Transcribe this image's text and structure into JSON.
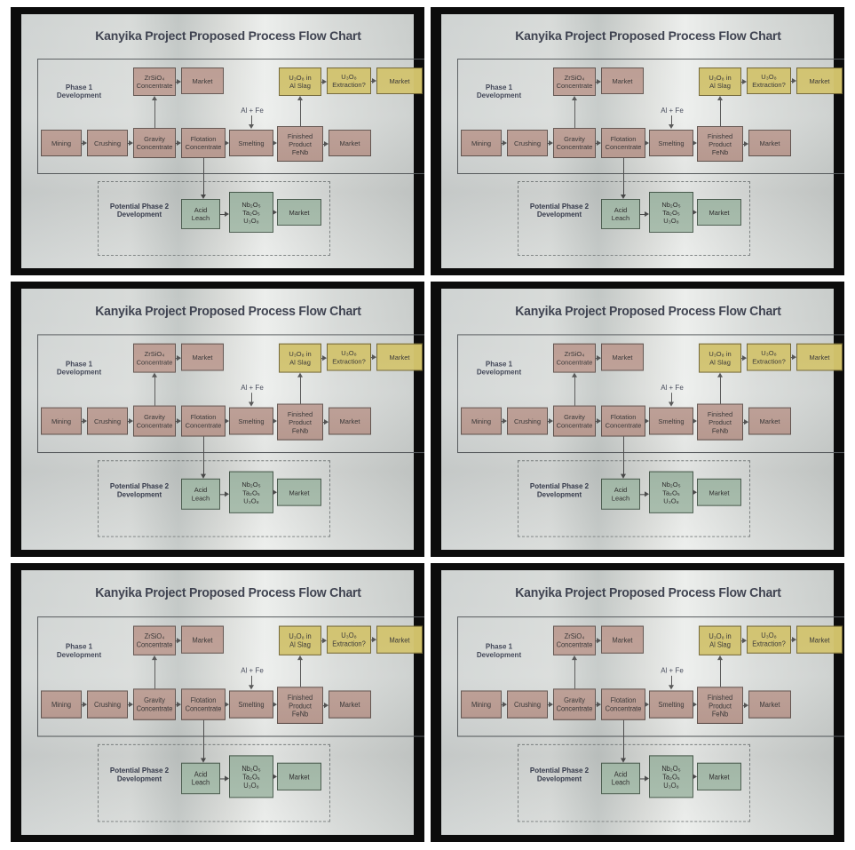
{
  "chart": {
    "title": "Kanyika Project Proposed Process Flow Chart",
    "phase1_label": "Phase 1\nDevelopment",
    "phase2_label": "Potential Phase 2\nDevelopment",
    "additive_label": "Al + Fe",
    "boxes": [
      {
        "id": "mining",
        "label": "Mining",
        "tone": "brown"
      },
      {
        "id": "crushing",
        "label": "Crushing",
        "tone": "brown"
      },
      {
        "id": "gravity",
        "label": "Gravity\nConcentrate",
        "tone": "brown"
      },
      {
        "id": "flotation",
        "label": "Flotation\nConcentrate",
        "tone": "brown"
      },
      {
        "id": "smelting",
        "label": "Smelting",
        "tone": "brown"
      },
      {
        "id": "finished",
        "label": "Finished\nProduct\nFeNb",
        "tone": "brown"
      },
      {
        "id": "market-main",
        "label": "Market",
        "tone": "brown"
      },
      {
        "id": "zrsio4",
        "label": "ZrSiO₄\nConcentrate",
        "tone": "brown"
      },
      {
        "id": "market-zr",
        "label": "Market",
        "tone": "brown"
      },
      {
        "id": "u3o8-slag",
        "label": "U₃O₈ in\nAl Slag",
        "tone": "yellow"
      },
      {
        "id": "u3o8-extract",
        "label": "U₃O₈\nExtraction?",
        "tone": "yellow"
      },
      {
        "id": "market-u",
        "label": "Market",
        "tone": "yellow"
      },
      {
        "id": "acid-leach",
        "label": "Acid\nLeach",
        "tone": "green"
      },
      {
        "id": "oxides",
        "label": "Nb₂O₅\nTa₂O₅\nU₃O₈",
        "tone": "green"
      },
      {
        "id": "market-p2",
        "label": "Market",
        "tone": "green"
      }
    ]
  },
  "panels": [
    {
      "id": "panel-1"
    },
    {
      "id": "panel-2"
    },
    {
      "id": "panel-3"
    },
    {
      "id": "panel-4"
    },
    {
      "id": "panel-5"
    },
    {
      "id": "panel-6"
    }
  ]
}
